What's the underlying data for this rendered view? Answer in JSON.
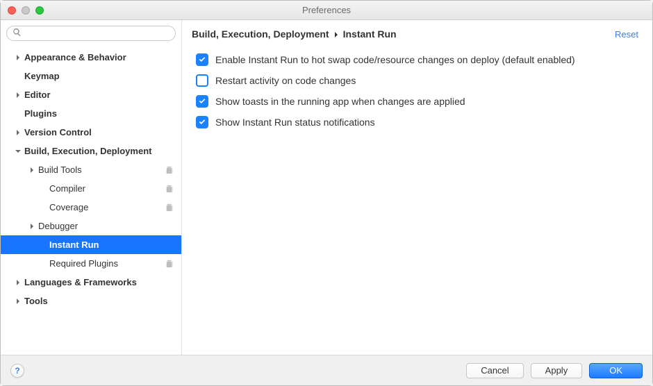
{
  "window": {
    "title": "Preferences"
  },
  "search": {
    "placeholder": ""
  },
  "sidebar": [
    {
      "label": "Appearance & Behavior",
      "level": 0,
      "bold": true,
      "expandable": true,
      "expanded": false
    },
    {
      "label": "Keymap",
      "level": 0,
      "bold": true,
      "expandable": false
    },
    {
      "label": "Editor",
      "level": 0,
      "bold": true,
      "expandable": true,
      "expanded": false
    },
    {
      "label": "Plugins",
      "level": 0,
      "bold": true,
      "expandable": false
    },
    {
      "label": "Version Control",
      "level": 0,
      "bold": true,
      "expandable": true,
      "expanded": false
    },
    {
      "label": "Build, Execution, Deployment",
      "level": 0,
      "bold": true,
      "expandable": true,
      "expanded": true
    },
    {
      "label": "Build Tools",
      "level": 1,
      "expandable": true,
      "expanded": false,
      "copyable": true
    },
    {
      "label": "Compiler",
      "level": 2,
      "expandable": false,
      "copyable": true
    },
    {
      "label": "Coverage",
      "level": 2,
      "expandable": false,
      "copyable": true
    },
    {
      "label": "Debugger",
      "level": 1,
      "expandable": true,
      "expanded": false
    },
    {
      "label": "Instant Run",
      "level": 2,
      "expandable": false,
      "selected": true,
      "bold": true
    },
    {
      "label": "Required Plugins",
      "level": 2,
      "expandable": false,
      "copyable": true
    },
    {
      "label": "Languages & Frameworks",
      "level": 0,
      "bold": true,
      "expandable": true,
      "expanded": false
    },
    {
      "label": "Tools",
      "level": 0,
      "bold": true,
      "expandable": true,
      "expanded": false
    }
  ],
  "content": {
    "breadcrumb": [
      "Build, Execution, Deployment",
      "Instant Run"
    ],
    "reset_label": "Reset",
    "options": [
      {
        "label": "Enable Instant Run to hot swap code/resource changes on deploy (default enabled)",
        "checked": true
      },
      {
        "label": "Restart activity on code changes",
        "checked": false
      },
      {
        "label": "Show toasts in the running app when changes are applied",
        "checked": true
      },
      {
        "label": "Show Instant Run status notifications",
        "checked": true
      }
    ]
  },
  "footer": {
    "help": "?",
    "cancel": "Cancel",
    "apply": "Apply",
    "ok": "OK"
  }
}
